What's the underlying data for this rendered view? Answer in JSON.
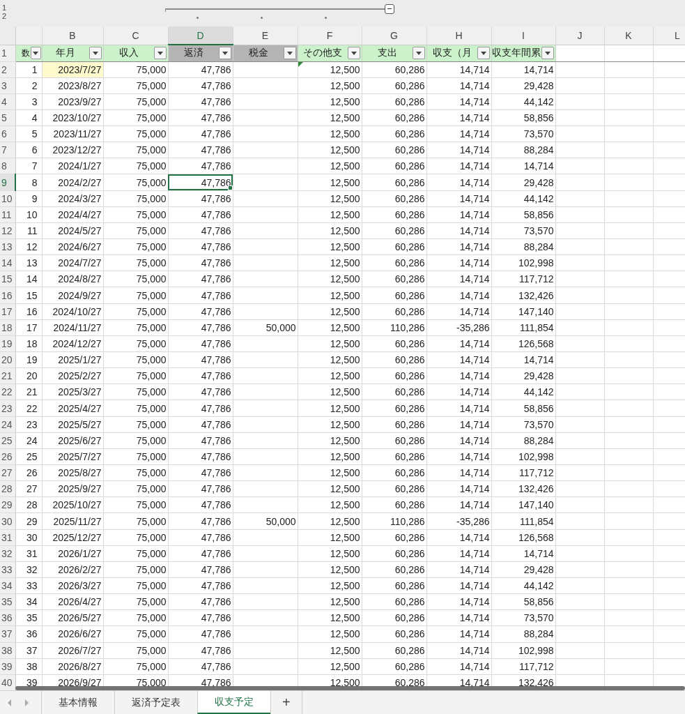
{
  "outline": {
    "levels": [
      "1",
      "2"
    ],
    "collapse_button": "−"
  },
  "columns": [
    {
      "selected": false
    },
    {
      "letter": "B",
      "selected": false
    },
    {
      "letter": "C",
      "selected": false
    },
    {
      "letter": "D",
      "selected": true
    },
    {
      "letter": "E",
      "selected": false
    },
    {
      "letter": "F",
      "selected": false
    },
    {
      "letter": "G",
      "selected": false
    },
    {
      "letter": "H",
      "selected": false
    },
    {
      "letter": "I",
      "selected": false
    },
    {
      "letter": "J",
      "selected": false
    },
    {
      "letter": "K",
      "selected": false
    },
    {
      "letter": "L",
      "selected": false
    }
  ],
  "header_row": {
    "row": "1",
    "cells": [
      {
        "label": "数",
        "color": "#ccf2cc"
      },
      {
        "label": "年月",
        "color": "#ccf2cc"
      },
      {
        "label": "収入",
        "color": "#ccf2cc"
      },
      {
        "label": "返済",
        "color": "#b4b4b4"
      },
      {
        "label": "税金",
        "color": "#b4b4b4"
      },
      {
        "label": "その他支",
        "color": "#ccf2cc"
      },
      {
        "label": "支出",
        "color": "#ccf2cc"
      },
      {
        "label": "収支（月",
        "color": "#ccf2cc"
      },
      {
        "label": "収支年間累",
        "color": "#ccf2cc"
      }
    ]
  },
  "rows": [
    {
      "row": "2",
      "selected": false,
      "cells": [
        "1",
        {
          "text": "2023/7/27",
          "kind": "highlight"
        },
        "75,000",
        "47,786",
        null,
        {
          "text": "12,500",
          "kind": "note"
        },
        "60,286",
        "14,714",
        "14,714"
      ]
    },
    {
      "row": "3",
      "selected": false,
      "cells": [
        "2",
        "2023/8/27",
        "75,000",
        "47,786",
        null,
        "12,500",
        "60,286",
        "14,714",
        "29,428"
      ]
    },
    {
      "row": "4",
      "selected": false,
      "cells": [
        "3",
        "2023/9/27",
        "75,000",
        "47,786",
        null,
        "12,500",
        "60,286",
        "14,714",
        "44,142"
      ]
    },
    {
      "row": "5",
      "selected": false,
      "cells": [
        "4",
        "2023/10/27",
        "75,000",
        "47,786",
        null,
        "12,500",
        "60,286",
        "14,714",
        "58,856"
      ]
    },
    {
      "row": "6",
      "selected": false,
      "cells": [
        "5",
        "2023/11/27",
        "75,000",
        "47,786",
        null,
        "12,500",
        "60,286",
        "14,714",
        "73,570"
      ]
    },
    {
      "row": "7",
      "selected": false,
      "cells": [
        "6",
        "2023/12/27",
        "75,000",
        "47,786",
        null,
        "12,500",
        "60,286",
        "14,714",
        "88,284"
      ]
    },
    {
      "row": "8",
      "selected": false,
      "cells": [
        "7",
        "2024/1/27",
        "75,000",
        "47,786",
        null,
        "12,500",
        "60,286",
        "14,714",
        "14,714"
      ]
    },
    {
      "row": "9",
      "selected": true,
      "cells": [
        "8",
        "2024/2/27",
        "75,000",
        "47,786",
        null,
        "12,500",
        "60,286",
        "14,714",
        "29,428"
      ]
    },
    {
      "row": "10",
      "selected": false,
      "cells": [
        "9",
        "2024/3/27",
        "75,000",
        "47,786",
        null,
        "12,500",
        "60,286",
        "14,714",
        "44,142"
      ]
    },
    {
      "row": "11",
      "selected": false,
      "cells": [
        "10",
        "2024/4/27",
        "75,000",
        "47,786",
        null,
        "12,500",
        "60,286",
        "14,714",
        "58,856"
      ]
    },
    {
      "row": "12",
      "selected": false,
      "cells": [
        "11",
        "2024/5/27",
        "75,000",
        "47,786",
        null,
        "12,500",
        "60,286",
        "14,714",
        "73,570"
      ]
    },
    {
      "row": "13",
      "selected": false,
      "cells": [
        "12",
        "2024/6/27",
        "75,000",
        "47,786",
        null,
        "12,500",
        "60,286",
        "14,714",
        "88,284"
      ]
    },
    {
      "row": "14",
      "selected": false,
      "cells": [
        "13",
        "2024/7/27",
        "75,000",
        "47,786",
        null,
        "12,500",
        "60,286",
        "14,714",
        "102,998"
      ]
    },
    {
      "row": "15",
      "selected": false,
      "cells": [
        "14",
        "2024/8/27",
        "75,000",
        "47,786",
        null,
        "12,500",
        "60,286",
        "14,714",
        "117,712"
      ]
    },
    {
      "row": "16",
      "selected": false,
      "cells": [
        "15",
        "2024/9/27",
        "75,000",
        "47,786",
        null,
        "12,500",
        "60,286",
        "14,714",
        "132,426"
      ]
    },
    {
      "row": "17",
      "selected": false,
      "cells": [
        "16",
        "2024/10/27",
        "75,000",
        "47,786",
        null,
        "12,500",
        "60,286",
        "14,714",
        "147,140"
      ]
    },
    {
      "row": "18",
      "selected": false,
      "cells": [
        "17",
        "2024/11/27",
        "75,000",
        "47,786",
        "50,000",
        "12,500",
        "110,286",
        "-35,286",
        "111,854"
      ]
    },
    {
      "row": "19",
      "selected": false,
      "cells": [
        "18",
        "2024/12/27",
        "75,000",
        "47,786",
        null,
        "12,500",
        "60,286",
        "14,714",
        "126,568"
      ]
    },
    {
      "row": "20",
      "selected": false,
      "cells": [
        "19",
        "2025/1/27",
        "75,000",
        "47,786",
        null,
        "12,500",
        "60,286",
        "14,714",
        "14,714"
      ]
    },
    {
      "row": "21",
      "selected": false,
      "cells": [
        "20",
        "2025/2/27",
        "75,000",
        "47,786",
        null,
        "12,500",
        "60,286",
        "14,714",
        "29,428"
      ]
    },
    {
      "row": "22",
      "selected": false,
      "cells": [
        "21",
        "2025/3/27",
        "75,000",
        "47,786",
        null,
        "12,500",
        "60,286",
        "14,714",
        "44,142"
      ]
    },
    {
      "row": "23",
      "selected": false,
      "cells": [
        "22",
        "2025/4/27",
        "75,000",
        "47,786",
        null,
        "12,500",
        "60,286",
        "14,714",
        "58,856"
      ]
    },
    {
      "row": "24",
      "selected": false,
      "cells": [
        "23",
        "2025/5/27",
        "75,000",
        "47,786",
        null,
        "12,500",
        "60,286",
        "14,714",
        "73,570"
      ]
    },
    {
      "row": "25",
      "selected": false,
      "cells": [
        "24",
        "2025/6/27",
        "75,000",
        "47,786",
        null,
        "12,500",
        "60,286",
        "14,714",
        "88,284"
      ]
    },
    {
      "row": "26",
      "selected": false,
      "cells": [
        "25",
        "2025/7/27",
        "75,000",
        "47,786",
        null,
        "12,500",
        "60,286",
        "14,714",
        "102,998"
      ]
    },
    {
      "row": "27",
      "selected": false,
      "cells": [
        "26",
        "2025/8/27",
        "75,000",
        "47,786",
        null,
        "12,500",
        "60,286",
        "14,714",
        "117,712"
      ]
    },
    {
      "row": "28",
      "selected": false,
      "cells": [
        "27",
        "2025/9/27",
        "75,000",
        "47,786",
        null,
        "12,500",
        "60,286",
        "14,714",
        "132,426"
      ]
    },
    {
      "row": "29",
      "selected": false,
      "cells": [
        "28",
        "2025/10/27",
        "75,000",
        "47,786",
        null,
        "12,500",
        "60,286",
        "14,714",
        "147,140"
      ]
    },
    {
      "row": "30",
      "selected": false,
      "cells": [
        "29",
        "2025/11/27",
        "75,000",
        "47,786",
        "50,000",
        "12,500",
        "110,286",
        "-35,286",
        "111,854"
      ]
    },
    {
      "row": "31",
      "selected": false,
      "cells": [
        "30",
        "2025/12/27",
        "75,000",
        "47,786",
        null,
        "12,500",
        "60,286",
        "14,714",
        "126,568"
      ]
    },
    {
      "row": "32",
      "selected": false,
      "cells": [
        "31",
        "2026/1/27",
        "75,000",
        "47,786",
        null,
        "12,500",
        "60,286",
        "14,714",
        "14,714"
      ]
    },
    {
      "row": "33",
      "selected": false,
      "cells": [
        "32",
        "2026/2/27",
        "75,000",
        "47,786",
        null,
        "12,500",
        "60,286",
        "14,714",
        "29,428"
      ]
    },
    {
      "row": "34",
      "selected": false,
      "cells": [
        "33",
        "2026/3/27",
        "75,000",
        "47,786",
        null,
        "12,500",
        "60,286",
        "14,714",
        "44,142"
      ]
    },
    {
      "row": "35",
      "selected": false,
      "cells": [
        "34",
        "2026/4/27",
        "75,000",
        "47,786",
        null,
        "12,500",
        "60,286",
        "14,714",
        "58,856"
      ]
    },
    {
      "row": "36",
      "selected": false,
      "cells": [
        "35",
        "2026/5/27",
        "75,000",
        "47,786",
        null,
        "12,500",
        "60,286",
        "14,714",
        "73,570"
      ]
    },
    {
      "row": "37",
      "selected": false,
      "cells": [
        "36",
        "2026/6/27",
        "75,000",
        "47,786",
        null,
        "12,500",
        "60,286",
        "14,714",
        "88,284"
      ]
    },
    {
      "row": "38",
      "selected": false,
      "cells": [
        "37",
        "2026/7/27",
        "75,000",
        "47,786",
        null,
        "12,500",
        "60,286",
        "14,714",
        "102,998"
      ]
    },
    {
      "row": "39",
      "selected": false,
      "cells": [
        "38",
        "2026/8/27",
        "75,000",
        "47,786",
        null,
        "12,500",
        "60,286",
        "14,714",
        "117,712"
      ]
    },
    {
      "row": "40",
      "selected": false,
      "cells": [
        "39",
        "2026/9/27",
        "75,000",
        "47,786",
        null,
        "12,500",
        "60,286",
        "14,714",
        "132,426"
      ]
    }
  ],
  "sheet_tabs": [
    {
      "label": "基本情報",
      "selected": false
    },
    {
      "label": "返済予定表",
      "selected": false
    },
    {
      "label": "収支予定",
      "selected": true
    }
  ],
  "add_sheet": "+"
}
